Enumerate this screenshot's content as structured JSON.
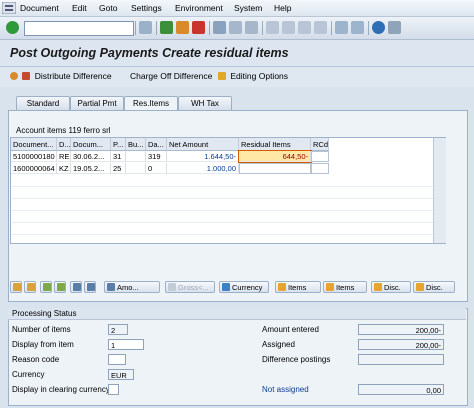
{
  "menu": [
    "Document",
    "Edit",
    "Goto",
    "Settings",
    "Environment",
    "System",
    "Help"
  ],
  "title": "Post Outgoing Payments Create residual items",
  "app_toolbar": {
    "distribute": "Distribute Difference",
    "charge_off": "Charge Off Difference",
    "editing_options": "Editing Options"
  },
  "tabs": [
    "Standard",
    "Partial Pmt",
    "Res.Items",
    "WH Tax"
  ],
  "active_tab": "Res.Items",
  "table": {
    "caption": "Account items 119 ferro srl",
    "headers": [
      "Document...",
      "D...",
      "Docum...",
      "P...",
      "Bu...",
      "Da...",
      "Net Amount",
      "Residual Items",
      "RCd"
    ],
    "rows": [
      [
        "5100000180",
        "RE",
        "30.06.2...",
        "31",
        "",
        "319",
        "1.644,50-",
        "644,50-",
        ""
      ],
      [
        "1600000064",
        "KZ",
        "19.05.2...",
        "25",
        "",
        "0",
        "1.000,00",
        "",
        ""
      ]
    ]
  },
  "table_buttons": [
    "Amo...",
    "Gross<...",
    "Currency",
    "Items",
    "Items",
    "Disc.",
    "Disc."
  ],
  "processing": {
    "title": "Processing Status",
    "number_of_items_label": "Number of items",
    "number_of_items": "2",
    "display_from_item_label": "Display from item",
    "display_from_item": "1",
    "reason_code_label": "Reason code",
    "reason_code": "",
    "currency_label": "Currency",
    "currency": "EUR",
    "display_clearing_label": "Display in clearing currency",
    "amount_entered_label": "Amount entered",
    "amount_entered": "200,00-",
    "assigned_label": "Assigned",
    "assigned": "200,00-",
    "difference_label": "Difference postings",
    "difference": "",
    "not_assigned_label": "Not assigned",
    "not_assigned": "0,00"
  },
  "colors": {
    "accent": "#0b3d91",
    "highlight": "#ffe8a6",
    "focus": "#d65a00"
  }
}
